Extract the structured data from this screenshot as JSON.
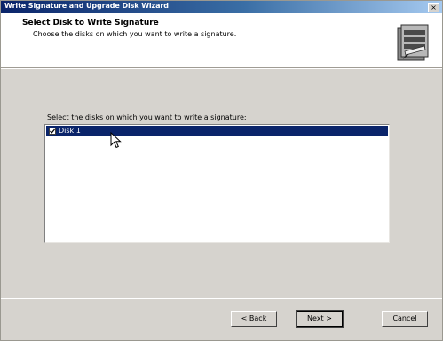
{
  "window": {
    "title": "Write Signature and Upgrade Disk Wizard",
    "close_glyph": "×"
  },
  "header": {
    "title": "Select Disk to Write Signature",
    "subtitle": "Choose the disks on which you want to write a signature.",
    "icon": "wizard-disk-icon"
  },
  "main": {
    "instruction": "Select the disks on which you want to write a signature:",
    "disks": [
      {
        "label": "Disk 1",
        "checked": true,
        "selected": true
      }
    ]
  },
  "buttons": {
    "back_label": "< Back",
    "next_label": "Next >",
    "cancel_label": "Cancel"
  },
  "colors": {
    "titlebar_start": "#0a246a",
    "titlebar_end": "#a6caf0",
    "selection": "#0a246a",
    "face": "#d6d3ce"
  }
}
